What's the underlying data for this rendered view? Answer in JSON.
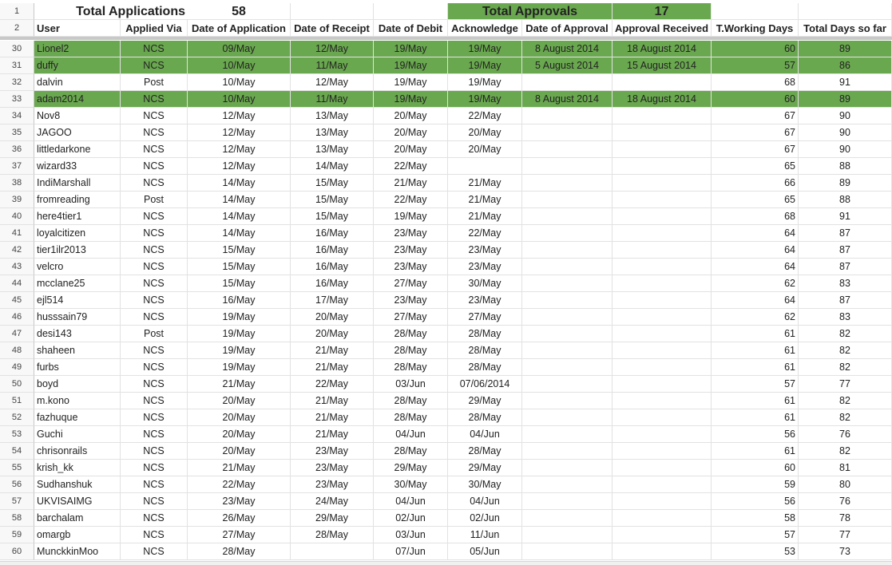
{
  "summary": {
    "row_number": "1",
    "total_applications_label": "Total Applications",
    "total_applications_value": "58",
    "total_approvals_label": "Total Approvals",
    "total_approvals_value": "17"
  },
  "header": {
    "row_number": "2",
    "columns": [
      "User",
      "Applied Via",
      "Date of Application",
      "Date of Receipt",
      "Date of Debit",
      "Acknowledge",
      "Date of Approval",
      "Approval Received",
      "T.Working Days",
      "Total Days so far"
    ]
  },
  "colors": {
    "approved_fill": "#6aa84f",
    "grid": "#e2e2e2",
    "row_header_bg": "#f8f8f8"
  },
  "rows": [
    {
      "n": "30",
      "user": "Lionel2",
      "via": "NCS",
      "app": "09/May",
      "receipt": "12/May",
      "debit": "19/May",
      "ack": "19/May",
      "approval": "8 August 2014",
      "received": "18 August 2014",
      "wdays": "60",
      "tdays": "89",
      "approved": true
    },
    {
      "n": "31",
      "user": "duffy",
      "via": "NCS",
      "app": "10/May",
      "receipt": "11/May",
      "debit": "19/May",
      "ack": "19/May",
      "approval": "5 August 2014",
      "received": "15 August 2014",
      "wdays": "57",
      "tdays": "86",
      "approved": true
    },
    {
      "n": "32",
      "user": "dalvin",
      "via": "Post",
      "app": "10/May",
      "receipt": "12/May",
      "debit": "19/May",
      "ack": "19/May",
      "approval": "",
      "received": "",
      "wdays": "68",
      "tdays": "91",
      "approved": false
    },
    {
      "n": "33",
      "user": "adam2014",
      "via": "NCS",
      "app": "10/May",
      "receipt": "11/May",
      "debit": "19/May",
      "ack": "19/May",
      "approval": "8 August 2014",
      "received": "18 August 2014",
      "wdays": "60",
      "tdays": "89",
      "approved": true
    },
    {
      "n": "34",
      "user": "Nov8",
      "via": "NCS",
      "app": "12/May",
      "receipt": "13/May",
      "debit": "20/May",
      "ack": "22/May",
      "approval": "",
      "received": "",
      "wdays": "67",
      "tdays": "90",
      "approved": false
    },
    {
      "n": "35",
      "user": "JAGOO",
      "via": "NCS",
      "app": "12/May",
      "receipt": "13/May",
      "debit": "20/May",
      "ack": "20/May",
      "approval": "",
      "received": "",
      "wdays": "67",
      "tdays": "90",
      "approved": false
    },
    {
      "n": "36",
      "user": "littledarkone",
      "via": "NCS",
      "app": "12/May",
      "receipt": "13/May",
      "debit": "20/May",
      "ack": "20/May",
      "approval": "",
      "received": "",
      "wdays": "67",
      "tdays": "90",
      "approved": false
    },
    {
      "n": "37",
      "user": "wizard33",
      "via": "NCS",
      "app": "12/May",
      "receipt": "14/May",
      "debit": "22/May",
      "ack": "",
      "approval": "",
      "received": "",
      "wdays": "65",
      "tdays": "88",
      "approved": false
    },
    {
      "n": "38",
      "user": "IndiMarshall",
      "via": "NCS",
      "app": "14/May",
      "receipt": "15/May",
      "debit": "21/May",
      "ack": "21/May",
      "approval": "",
      "received": "",
      "wdays": "66",
      "tdays": "89",
      "approved": false
    },
    {
      "n": "39",
      "user": "fromreading",
      "via": "Post",
      "app": "14/May",
      "receipt": "15/May",
      "debit": "22/May",
      "ack": "21/May",
      "approval": "",
      "received": "",
      "wdays": "65",
      "tdays": "88",
      "approved": false
    },
    {
      "n": "40",
      "user": "here4tier1",
      "via": "NCS",
      "app": "14/May",
      "receipt": "15/May",
      "debit": "19/May",
      "ack": "21/May",
      "approval": "",
      "received": "",
      "wdays": "68",
      "tdays": "91",
      "approved": false
    },
    {
      "n": "41",
      "user": "loyalcitizen",
      "via": "NCS",
      "app": "14/May",
      "receipt": "16/May",
      "debit": "23/May",
      "ack": "22/May",
      "approval": "",
      "received": "",
      "wdays": "64",
      "tdays": "87",
      "approved": false
    },
    {
      "n": "42",
      "user": "tier1ilr2013",
      "via": "NCS",
      "app": "15/May",
      "receipt": "16/May",
      "debit": "23/May",
      "ack": "23/May",
      "approval": "",
      "received": "",
      "wdays": "64",
      "tdays": "87",
      "approved": false
    },
    {
      "n": "43",
      "user": "velcro",
      "via": "NCS",
      "app": "15/May",
      "receipt": "16/May",
      "debit": "23/May",
      "ack": "23/May",
      "approval": "",
      "received": "",
      "wdays": "64",
      "tdays": "87",
      "approved": false
    },
    {
      "n": "44",
      "user": "mcclane25",
      "via": "NCS",
      "app": "15/May",
      "receipt": "16/May",
      "debit": "27/May",
      "ack": "30/May",
      "approval": "",
      "received": "",
      "wdays": "62",
      "tdays": "83",
      "approved": false
    },
    {
      "n": "45",
      "user": "ejl514",
      "via": "NCS",
      "app": "16/May",
      "receipt": "17/May",
      "debit": "23/May",
      "ack": "23/May",
      "approval": "",
      "received": "",
      "wdays": "64",
      "tdays": "87",
      "approved": false
    },
    {
      "n": "46",
      "user": "husssain79",
      "via": "NCS",
      "app": "19/May",
      "receipt": "20/May",
      "debit": "27/May",
      "ack": "27/May",
      "approval": "",
      "received": "",
      "wdays": "62",
      "tdays": "83",
      "approved": false
    },
    {
      "n": "47",
      "user": "desi143",
      "via": "Post",
      "app": "19/May",
      "receipt": "20/May",
      "debit": "28/May",
      "ack": "28/May",
      "approval": "",
      "received": "",
      "wdays": "61",
      "tdays": "82",
      "approved": false
    },
    {
      "n": "48",
      "user": "shaheen",
      "via": "NCS",
      "app": "19/May",
      "receipt": "21/May",
      "debit": "28/May",
      "ack": "28/May",
      "approval": "",
      "received": "",
      "wdays": "61",
      "tdays": "82",
      "approved": false
    },
    {
      "n": "49",
      "user": "furbs",
      "via": "NCS",
      "app": "19/May",
      "receipt": "21/May",
      "debit": "28/May",
      "ack": "28/May",
      "approval": "",
      "received": "",
      "wdays": "61",
      "tdays": "82",
      "approved": false
    },
    {
      "n": "50",
      "user": "boyd",
      "via": "NCS",
      "app": "21/May",
      "receipt": "22/May",
      "debit": "03/Jun",
      "ack": "07/06/2014",
      "approval": "",
      "received": "",
      "wdays": "57",
      "tdays": "77",
      "approved": false
    },
    {
      "n": "51",
      "user": "m.kono",
      "via": "NCS",
      "app": "20/May",
      "receipt": "21/May",
      "debit": "28/May",
      "ack": "29/May",
      "approval": "",
      "received": "",
      "wdays": "61",
      "tdays": "82",
      "approved": false
    },
    {
      "n": "52",
      "user": "fazhuque",
      "via": "NCS",
      "app": "20/May",
      "receipt": "21/May",
      "debit": "28/May",
      "ack": "28/May",
      "approval": "",
      "received": "",
      "wdays": "61",
      "tdays": "82",
      "approved": false
    },
    {
      "n": "53",
      "user": "Guchi",
      "via": "NCS",
      "app": "20/May",
      "receipt": "21/May",
      "debit": "04/Jun",
      "ack": "04/Jun",
      "approval": "",
      "received": "",
      "wdays": "56",
      "tdays": "76",
      "approved": false
    },
    {
      "n": "54",
      "user": "chrisonrails",
      "via": "NCS",
      "app": "20/May",
      "receipt": "23/May",
      "debit": "28/May",
      "ack": "28/May",
      "approval": "",
      "received": "",
      "wdays": "61",
      "tdays": "82",
      "approved": false
    },
    {
      "n": "55",
      "user": "krish_kk",
      "via": "NCS",
      "app": "21/May",
      "receipt": "23/May",
      "debit": "29/May",
      "ack": "29/May",
      "approval": "",
      "received": "",
      "wdays": "60",
      "tdays": "81",
      "approved": false
    },
    {
      "n": "56",
      "user": "Sudhanshuk",
      "via": "NCS",
      "app": "22/May",
      "receipt": "23/May",
      "debit": "30/May",
      "ack": "30/May",
      "approval": "",
      "received": "",
      "wdays": "59",
      "tdays": "80",
      "approved": false
    },
    {
      "n": "57",
      "user": "UKVISAIMG",
      "via": "NCS",
      "app": "23/May",
      "receipt": "24/May",
      "debit": "04/Jun",
      "ack": "04/Jun",
      "approval": "",
      "received": "",
      "wdays": "56",
      "tdays": "76",
      "approved": false
    },
    {
      "n": "58",
      "user": "barchalam",
      "via": "NCS",
      "app": "26/May",
      "receipt": "29/May",
      "debit": "02/Jun",
      "ack": "02/Jun",
      "approval": "",
      "received": "",
      "wdays": "58",
      "tdays": "78",
      "approved": false
    },
    {
      "n": "59",
      "user": "omargb",
      "via": "NCS",
      "app": "27/May",
      "receipt": "28/May",
      "debit": "03/Jun",
      "ack": "11/Jun",
      "approval": "",
      "received": "",
      "wdays": "57",
      "tdays": "77",
      "approved": false
    },
    {
      "n": "60",
      "user": "MunckkinMoo",
      "via": "NCS",
      "app": "28/May",
      "receipt": "",
      "debit": "07/Jun",
      "ack": "05/Jun",
      "approval": "",
      "received": "",
      "wdays": "53",
      "tdays": "73",
      "approved": false
    }
  ]
}
